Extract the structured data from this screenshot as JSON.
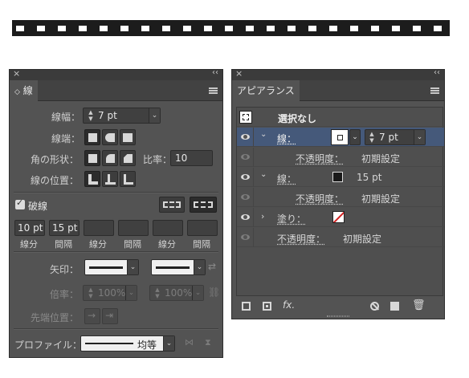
{
  "stroke_panel": {
    "tab_label": "線",
    "weight_label": "線幅：",
    "weight_value": "7 pt",
    "cap_label": "線端：",
    "corner_label": "角の形状：",
    "limit_label": "比率：",
    "limit_value": "10",
    "align_label": "線の位置：",
    "dashed_label": "破線",
    "dash_values": [
      "10 pt",
      "15 pt",
      "",
      "",
      "",
      ""
    ],
    "dash_labels": [
      "線分",
      "間隔",
      "線分",
      "間隔",
      "線分",
      "間隔"
    ],
    "arrowheads_label": "矢印：",
    "scale_label": "倍率：",
    "scale_values": [
      "100%",
      "100%"
    ],
    "align_arrow_label": "先端位置：",
    "profile_label": "プロファイル：",
    "profile_value": "均等"
  },
  "appearance_panel": {
    "tab_label": "アピアランス",
    "header_label": "選択なし",
    "rows": [
      {
        "label": "線：",
        "value": "7 pt",
        "swatch": "white"
      },
      {
        "label": "不透明度：",
        "value": "初期設定"
      },
      {
        "label": "線：",
        "value": "15 pt",
        "swatch": "black"
      },
      {
        "label": "不透明度：",
        "value": "初期設定"
      },
      {
        "label": "塗り：",
        "swatch": "none"
      },
      {
        "label": "不透明度：",
        "value": "初期設定"
      }
    ],
    "footer_fx": "fx."
  },
  "colors": {
    "panel_bg": "#535353",
    "highlight_row": "#45597a",
    "none_swatch_slash": "#d22020"
  }
}
